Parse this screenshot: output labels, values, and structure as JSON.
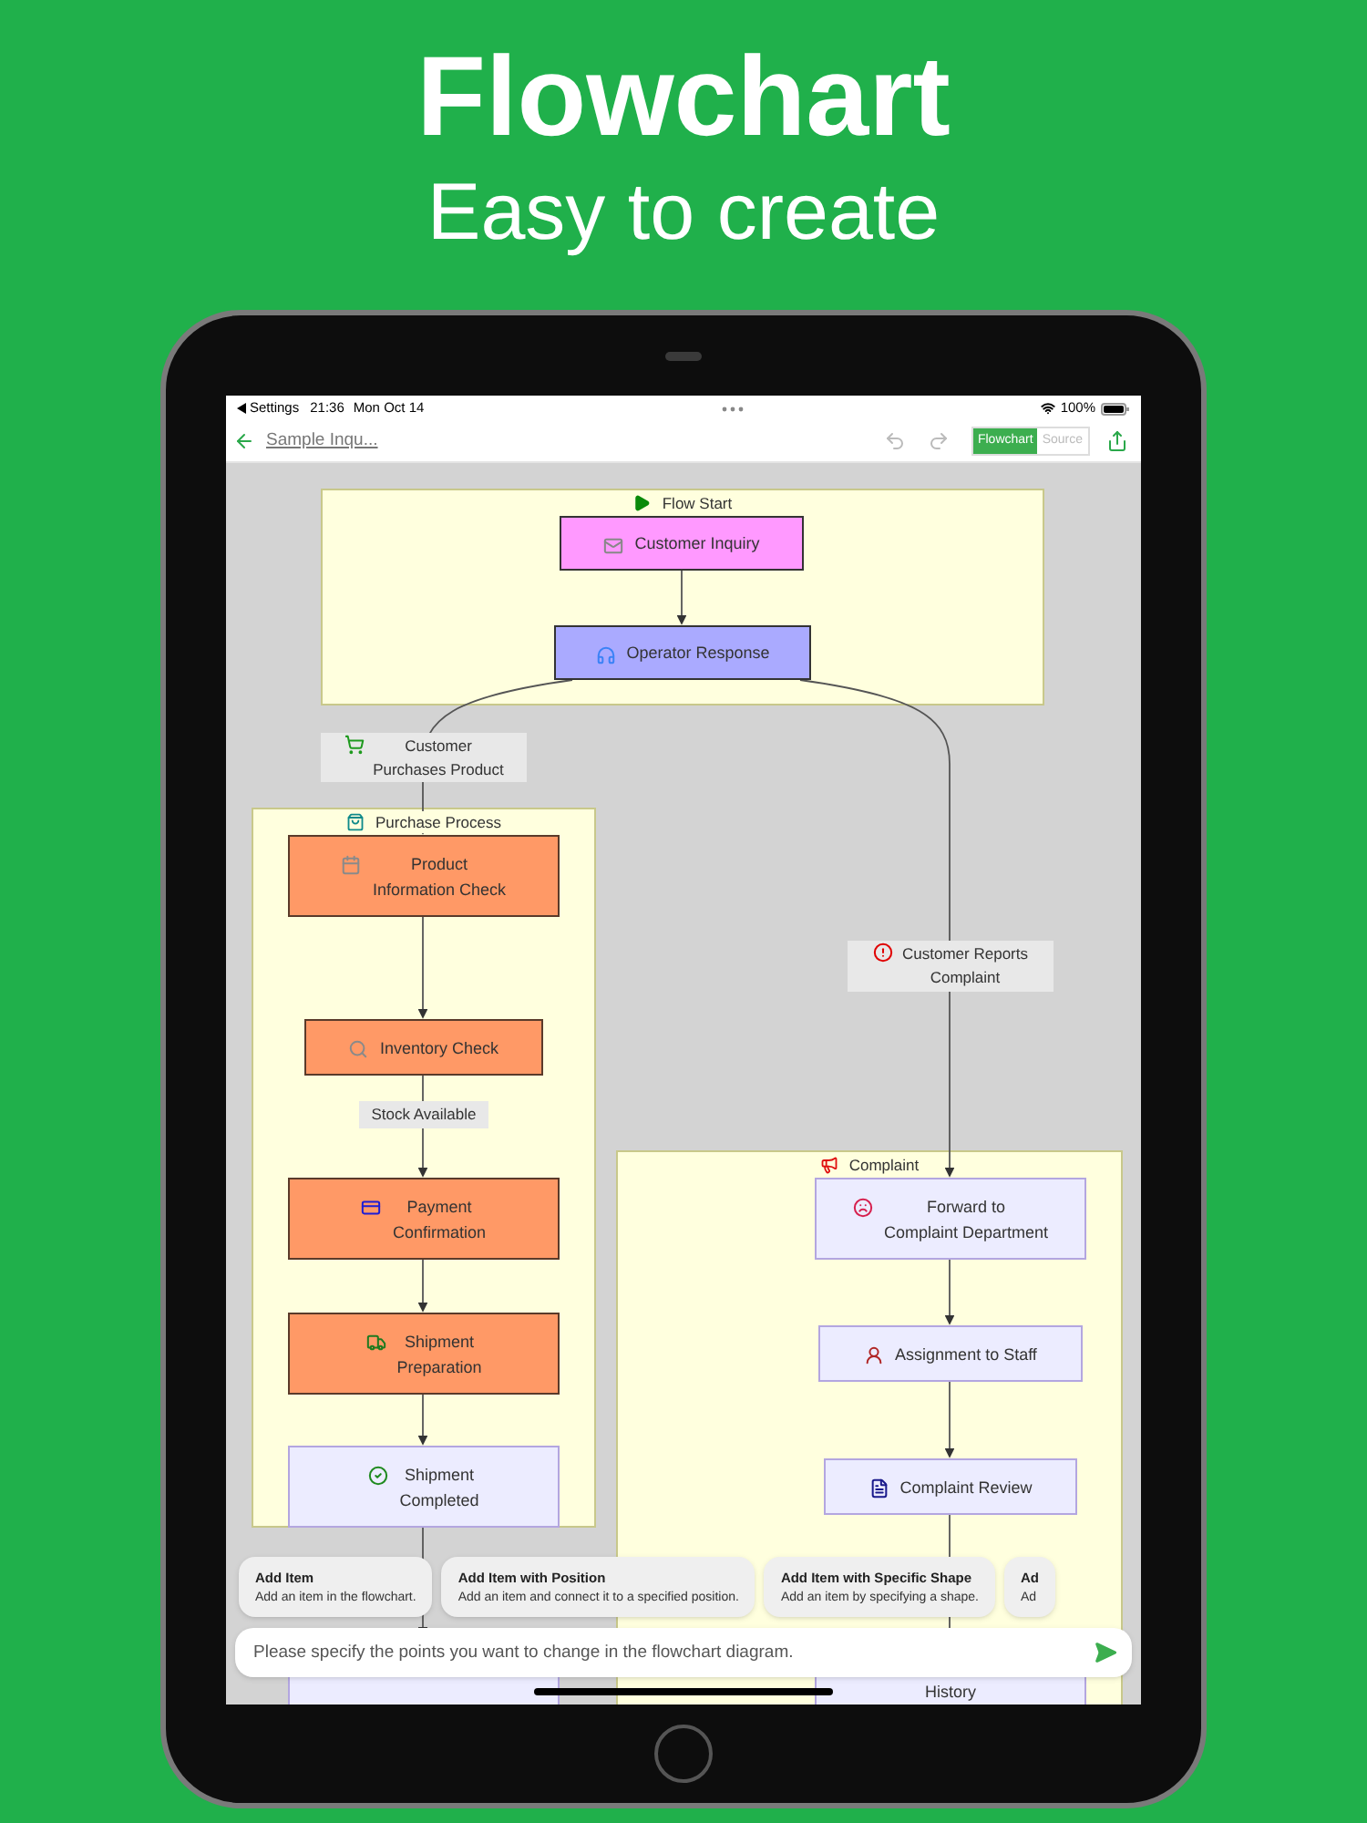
{
  "header": {
    "title": "Flowchart",
    "subtitle": "Easy to create"
  },
  "status_bar": {
    "back_label": "Settings",
    "time": "21:36",
    "date": "Mon Oct 14",
    "battery": "100%"
  },
  "nav": {
    "title": "Sample Inqu...",
    "tabs": [
      {
        "label": "Flowchart",
        "selected": true
      },
      {
        "label": "Source",
        "selected": false
      }
    ]
  },
  "flowchart": {
    "groups": [
      {
        "label": "Flow Start"
      },
      {
        "label": "Purchase Process"
      },
      {
        "label": "Complaint"
      }
    ],
    "nodes": [
      {
        "label": "Customer Inquiry",
        "color": "#ff99ff"
      },
      {
        "label": "Operator Response",
        "color": "#aaaaff"
      },
      {
        "label": "Product\nInformation Check",
        "color": "#ff9966"
      },
      {
        "label": "Inventory Check",
        "color": "#ff9966"
      },
      {
        "label": "Payment\nConfirmation",
        "color": "#ff9966"
      },
      {
        "label": "Shipment\nPreparation",
        "color": "#ff9966"
      },
      {
        "label": "Shipment\nCompleted",
        "color": "#ececff"
      },
      {
        "label": "Forward to\nComplaint Department",
        "color": "#ececff"
      },
      {
        "label": "Assignment to Staff",
        "color": "#ececff"
      },
      {
        "label": "Complaint Review",
        "color": "#ececff"
      },
      {
        "label": "History",
        "color": "#ececff"
      }
    ],
    "edge_labels": [
      {
        "label": "Customer\nPurchases Product"
      },
      {
        "label": "Customer Reports\nComplaint"
      },
      {
        "label": "Stock Available"
      }
    ]
  },
  "suggestions": [
    {
      "title": "Add Item",
      "description": "Add an item in the flowchart."
    },
    {
      "title": "Add Item with Position",
      "description": "Add an item and connect it to a specified position."
    },
    {
      "title": "Add Item with Specific Shape",
      "description": "Add an item by specifying a shape."
    },
    {
      "title": "Ad",
      "description": "Ad"
    }
  ],
  "prompt": {
    "placeholder": "Please specify the points you want to change in the flowchart diagram."
  }
}
